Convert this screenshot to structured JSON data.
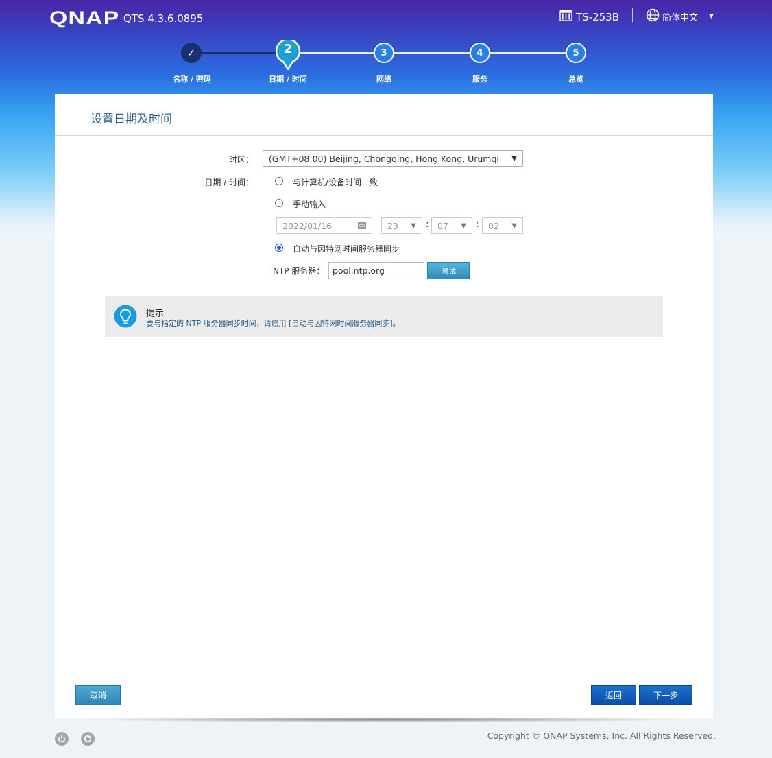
{
  "header": {
    "logo": "QNAP",
    "version": "QTS 4.3.6.0895",
    "device": "TS-253B",
    "language": "简体中文"
  },
  "steps": [
    {
      "symbol": "✓",
      "label": "名称 / 密码",
      "state": "done"
    },
    {
      "symbol": "2",
      "label": "日期 / 时间",
      "state": "current"
    },
    {
      "symbol": "3",
      "label": "网络",
      "state": "pending"
    },
    {
      "symbol": "4",
      "label": "服务",
      "state": "pending"
    },
    {
      "symbol": "5",
      "label": "总览",
      "state": "pending"
    }
  ],
  "panel": {
    "title": "设置日期及时间",
    "timezone_label": "时区：",
    "timezone_value": "(GMT+08:00) Beijing, Chongqing, Hong Kong, Urumqi",
    "datetime_label": "日期 / 时间：",
    "option_sync_pc": "与计算机/设备时间一致",
    "option_manual": "手动输入",
    "manual_date": "2022/01/16",
    "manual_hour": "23",
    "manual_minute": "07",
    "manual_second": "02",
    "option_ntp": "自动与因特网时间服务器同步",
    "selected_option": "ntp",
    "ntp_label": "NTP 服务器：",
    "ntp_value": "pool.ntp.org",
    "test_button": "测试"
  },
  "tip": {
    "title": "提示",
    "text": "要与指定的 NTP 服务器同步时间，请启用 [自动与因特网时间服务器同步]。"
  },
  "buttons": {
    "cancel": "取消",
    "back": "返回",
    "next": "下一步"
  },
  "footer": {
    "copyright": "Copyright © QNAP Systems, Inc. All Rights Reserved."
  },
  "colors": {
    "done_step": "#1a2f6e",
    "current_step": "#1e9fd6",
    "accent": "#2166c6"
  }
}
